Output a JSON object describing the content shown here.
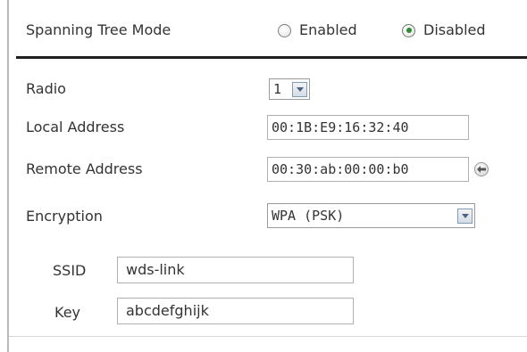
{
  "spanning_tree": {
    "label": "Spanning Tree Mode",
    "options": [
      {
        "label": "Enabled",
        "checked": false
      },
      {
        "label": "Disabled",
        "checked": true
      }
    ]
  },
  "radio": {
    "label": "Radio",
    "value": "1"
  },
  "local_address": {
    "label": "Local Address",
    "value": "00:1B:E9:16:32:40"
  },
  "remote_address": {
    "label": "Remote Address",
    "value": "00:30:ab:00:00:b0",
    "copy_icon": "arrow-left-icon"
  },
  "encryption": {
    "label": "Encryption",
    "value": "WPA (PSK)"
  },
  "ssid": {
    "label": "SSID",
    "value": "wds-link"
  },
  "key": {
    "label": "Key",
    "value": "abcdefghijk"
  },
  "colors": {
    "radio_checked": "#2c8d2c",
    "divider": "#1f1f1f",
    "dropdown_arrow": "#4d6185"
  }
}
